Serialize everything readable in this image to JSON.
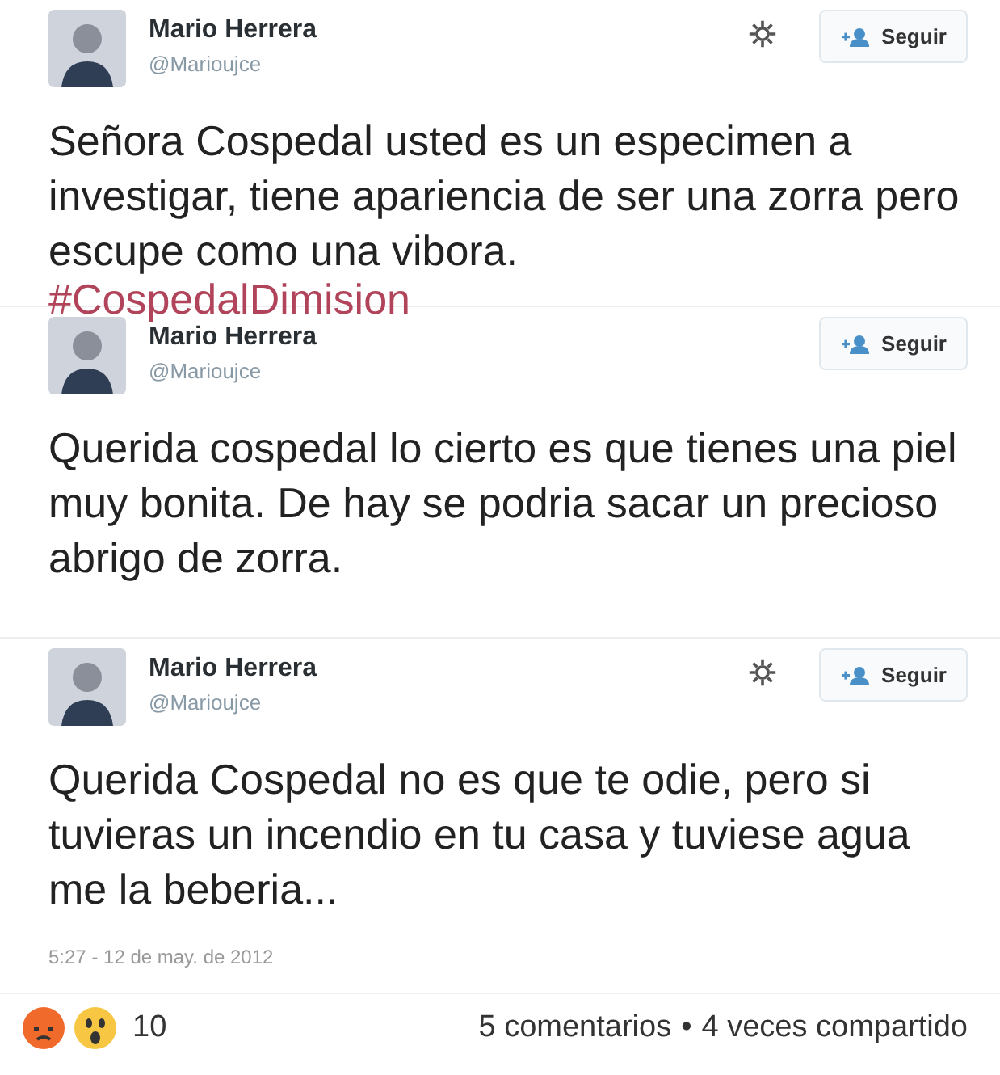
{
  "tweets": [
    {
      "name": "Mario Herrera",
      "handle": "@Marioujce",
      "has_settings": true,
      "follow_label": "Seguir",
      "text": "Señora Cospedal usted es un especimen a investigar, tiene apariencia de ser una zorra pero escupe como una vibora.",
      "hashtag": "#CospedalDimision"
    },
    {
      "name": "Mario Herrera",
      "handle": "@Marioujce",
      "has_settings": false,
      "follow_label": "Seguir",
      "text": "Querida cospedal lo cierto es que tienes una piel muy bonita. De hay se podria sacar un precioso abrigo de zorra."
    },
    {
      "name": "Mario Herrera",
      "handle": "@Marioujce",
      "has_settings": true,
      "follow_label": "Seguir",
      "text": "Querida Cospedal no es que te odie, pero si tuvieras un incendio en tu casa y tuviese agua me la beberia...",
      "date": "5:27 - 12 de may. de 2012"
    }
  ],
  "footer": {
    "reactions": [
      {
        "kind": "angry"
      },
      {
        "kind": "wow"
      }
    ],
    "reaction_count": "10",
    "comments": "5 comentarios",
    "separator": "•",
    "shares": "4 veces compartido"
  }
}
